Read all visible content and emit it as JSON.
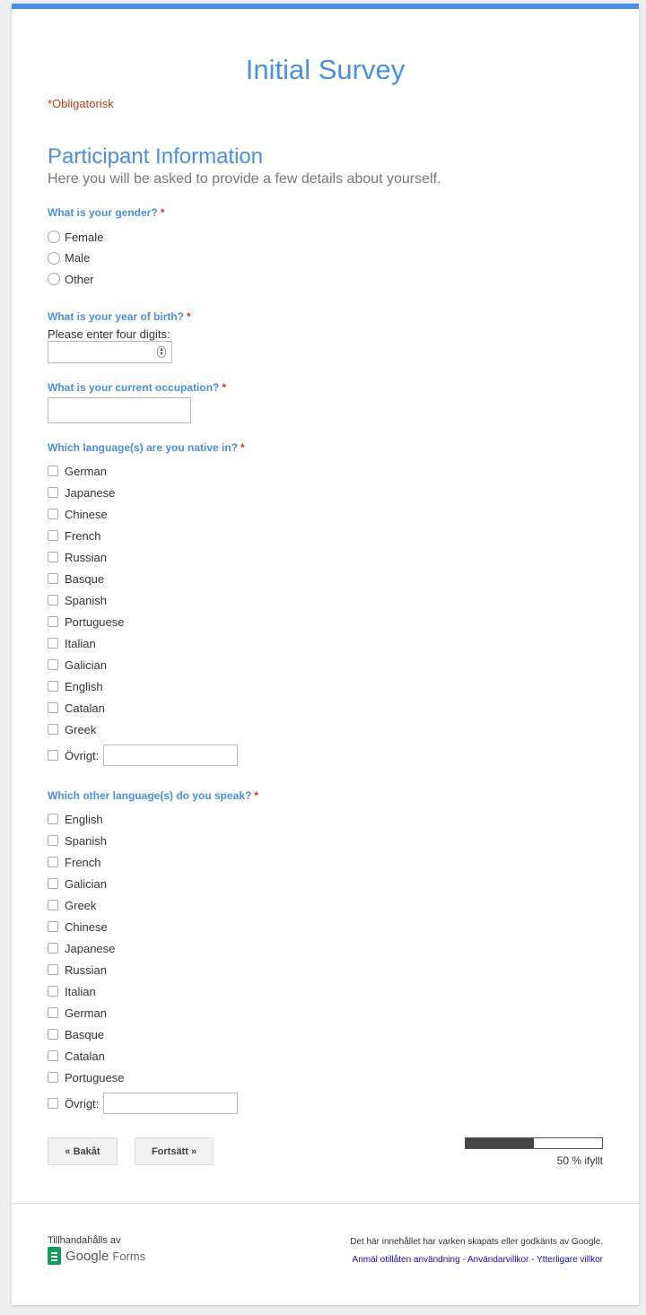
{
  "form": {
    "title": "Initial Survey",
    "required_note": "*Obligatorisk",
    "section_title": "Participant Information",
    "section_desc": "Here you will be asked to provide a few details about yourself."
  },
  "q_gender": {
    "title": "What is your gender?",
    "required": "*",
    "options": [
      "Female",
      "Male",
      "Other"
    ]
  },
  "q_birth": {
    "title": "What is your year of birth?",
    "required": "*",
    "help": "Please enter four digits:",
    "value": ""
  },
  "q_occupation": {
    "title": "What is your current occupation?",
    "required": "*",
    "value": ""
  },
  "q_native": {
    "title": "Which language(s) are you native in?",
    "required": "*",
    "options": [
      "German",
      "Japanese",
      "Chinese",
      "French",
      "Russian",
      "Basque",
      "Spanish",
      "Portuguese",
      "Italian",
      "Galician",
      "English",
      "Catalan",
      "Greek"
    ],
    "other_label": "Övrigt:"
  },
  "q_other_lang": {
    "title": "Which other language(s) do you speak?",
    "required": "*",
    "options": [
      "English",
      "Spanish",
      "French",
      "Galician",
      "Greek",
      "Chinese",
      "Japanese",
      "Russian",
      "Italian",
      "German",
      "Basque",
      "Catalan",
      "Portuguese"
    ],
    "other_label": "Övrigt:"
  },
  "nav": {
    "back_label": "« Bakåt",
    "next_label": "Fortsätt »",
    "progress_fraction": 0.5,
    "progress_text": "50 % ifyllt"
  },
  "footer": {
    "provided_by": "Tillhandahålls av",
    "logo_google": "Google",
    "logo_forms": "Forms",
    "disclaimer": "Det här innehållet har varken skapats eller godkänts av Google.",
    "link_abuse": "Anmäl otillåten användning",
    "link_terms": "Användarvillkor",
    "link_extra": "Ytterligare villkor",
    "separator": " - "
  },
  "colors": {
    "accent": "#4a90dc",
    "required": "#c43b1d",
    "link": "#1a0dab"
  }
}
